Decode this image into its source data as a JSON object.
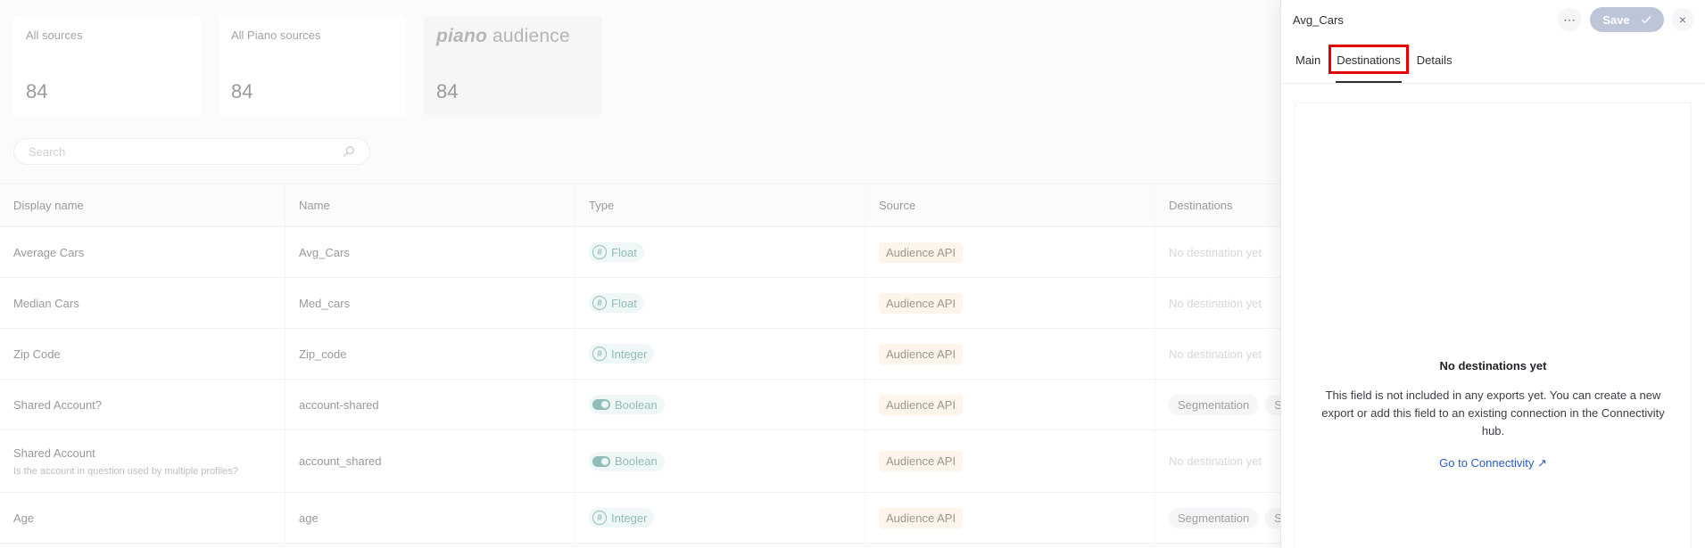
{
  "cards": [
    {
      "title": "All sources",
      "count": "84"
    },
    {
      "title": "All Piano sources",
      "count": "84"
    },
    {
      "logo_bold": "piano",
      "logo_light": "audience",
      "count": "84"
    }
  ],
  "search": {
    "placeholder": "Search"
  },
  "table": {
    "headers": [
      "Display name",
      "Name",
      "Type",
      "Source",
      "Destinations"
    ],
    "rows": [
      {
        "display_name": "Average Cars",
        "description": "",
        "name": "Avg_Cars",
        "type": "Float",
        "type_icon": "hash-icon",
        "source": "Audience API",
        "destinations_empty": "No destination yet",
        "destinations": []
      },
      {
        "display_name": "Median Cars",
        "description": "",
        "name": "Med_cars",
        "type": "Float",
        "type_icon": "hash-icon",
        "source": "Audience API",
        "destinations_empty": "No destination yet",
        "destinations": []
      },
      {
        "display_name": "Zip Code",
        "description": "",
        "name": "Zip_code",
        "type": "Integer",
        "type_icon": "hash-icon",
        "source": "Audience API",
        "destinations_empty": "No destination yet",
        "destinations": []
      },
      {
        "display_name": "Shared Account?",
        "description": "",
        "name": "account-shared",
        "type": "Boolean",
        "type_icon": "toggle-icon",
        "source": "Audience API",
        "destinations_empty": "",
        "destinations": [
          "Segmentation",
          "S"
        ]
      },
      {
        "display_name": "Shared Account",
        "description": "Is the account in question used by multiple profiles?",
        "name": "account_shared",
        "type": "Boolean",
        "type_icon": "toggle-icon",
        "source": "Audience API",
        "destinations_empty": "No destination yet",
        "destinations": []
      },
      {
        "display_name": "Age",
        "description": "",
        "name": "age",
        "type": "Integer",
        "type_icon": "hash-icon",
        "source": "Audience API",
        "destinations_empty": "",
        "destinations": [
          "Segmentation",
          "S"
        ]
      }
    ]
  },
  "drawer": {
    "title": "Avg_Cars",
    "more_icon": "⋯",
    "save_label": "Save",
    "close_icon": "×",
    "tabs": [
      {
        "label": "Main",
        "active": false
      },
      {
        "label": "Destinations",
        "active": true
      },
      {
        "label": "Details",
        "active": false
      }
    ],
    "empty_title": "No destinations yet",
    "empty_text": "This field is not included in any exports yet. You can create a new export or add this field to an existing connection in the Connectivity hub.",
    "link_label": "Go to Connectivity",
    "link_icon": "↗"
  },
  "colors": {
    "highlight": "#e50000",
    "accent_teal": "#3e8c86",
    "source_bg": "#fbeedd",
    "link": "#2c5ac6",
    "save_bg": "#bcc6d8"
  }
}
